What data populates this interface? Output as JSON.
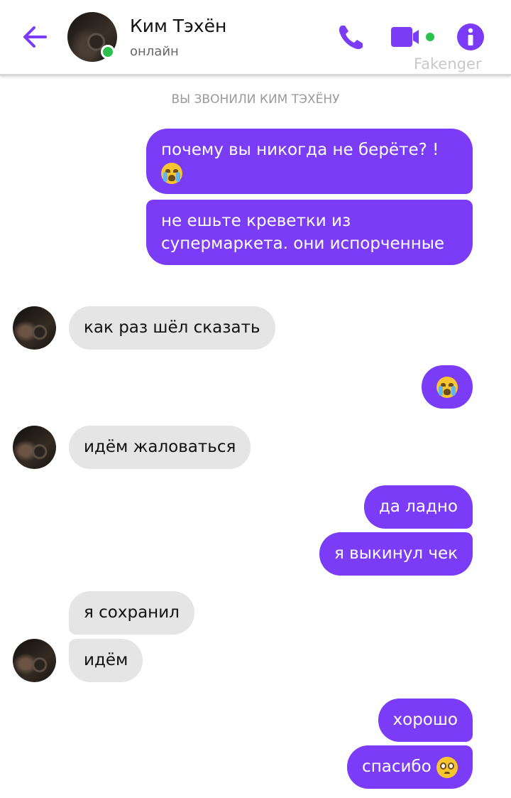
{
  "header": {
    "back_icon": "arrow-left-icon",
    "contact_name": "Ким Тэхён",
    "status": "онлайн",
    "call_icon": "phone-icon",
    "video_icon": "video-camera-icon",
    "info_icon": "info-icon",
    "watermark": "Fakenger",
    "accent_color": "#7a3cf6",
    "online_color": "#2bc24b"
  },
  "system_note": "ВЫ ЗВОНИЛИ КИМ ТЭХЁНУ",
  "messages": [
    {
      "side": "out",
      "text": "почему вы никогда не берёте? !",
      "emoji": "loudly-crying-face"
    },
    {
      "side": "out",
      "text": "не ешьте креветки из супермаркета. они испорченные"
    },
    {
      "side": "in",
      "text": "как раз шёл сказать"
    },
    {
      "side": "out",
      "text": "",
      "emoji": "loudly-crying-face"
    },
    {
      "side": "in",
      "text": "идём жаловаться"
    },
    {
      "side": "out",
      "text": "да ладно"
    },
    {
      "side": "out",
      "text": "я выкинул чек"
    },
    {
      "side": "in",
      "text": "я сохранил"
    },
    {
      "side": "in",
      "text": "идём"
    },
    {
      "side": "out",
      "text": "хорошо"
    },
    {
      "side": "out",
      "text": "спасибо",
      "emoji": "pleading-face"
    }
  ]
}
